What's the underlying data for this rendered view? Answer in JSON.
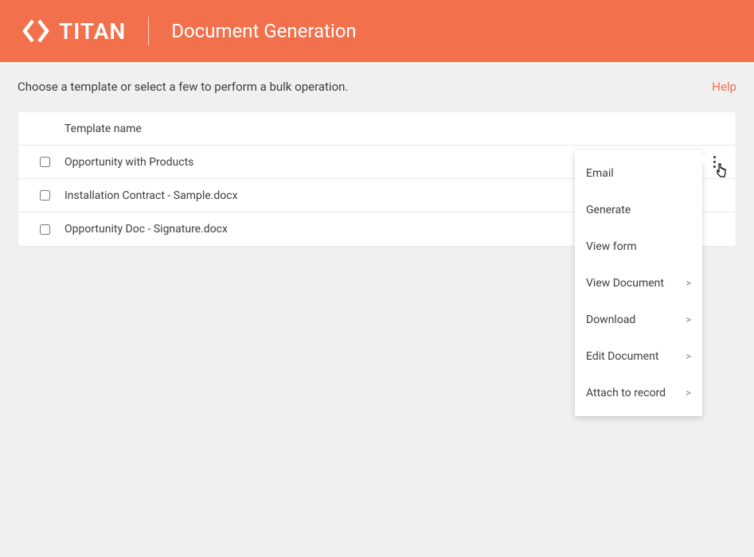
{
  "header": {
    "logo_text": "TITAN",
    "subtitle": "Document Generation"
  },
  "instruction": "Choose a template or select a few to perform a bulk operation.",
  "help_label": "Help",
  "table": {
    "header_label": "Template name",
    "rows": [
      {
        "name": "Opportunity with Products"
      },
      {
        "name": "Installation Contract - Sample.docx"
      },
      {
        "name": "Opportunity Doc - Signature.docx"
      }
    ]
  },
  "dropdown": {
    "items": [
      {
        "label": "Email",
        "has_sub": false
      },
      {
        "label": "Generate",
        "has_sub": false
      },
      {
        "label": "View form",
        "has_sub": false
      },
      {
        "label": "View Document",
        "has_sub": true
      },
      {
        "label": "Download",
        "has_sub": true
      },
      {
        "label": "Edit Document",
        "has_sub": true
      },
      {
        "label": "Attach to record",
        "has_sub": true
      }
    ],
    "sub_indicator": ">"
  }
}
